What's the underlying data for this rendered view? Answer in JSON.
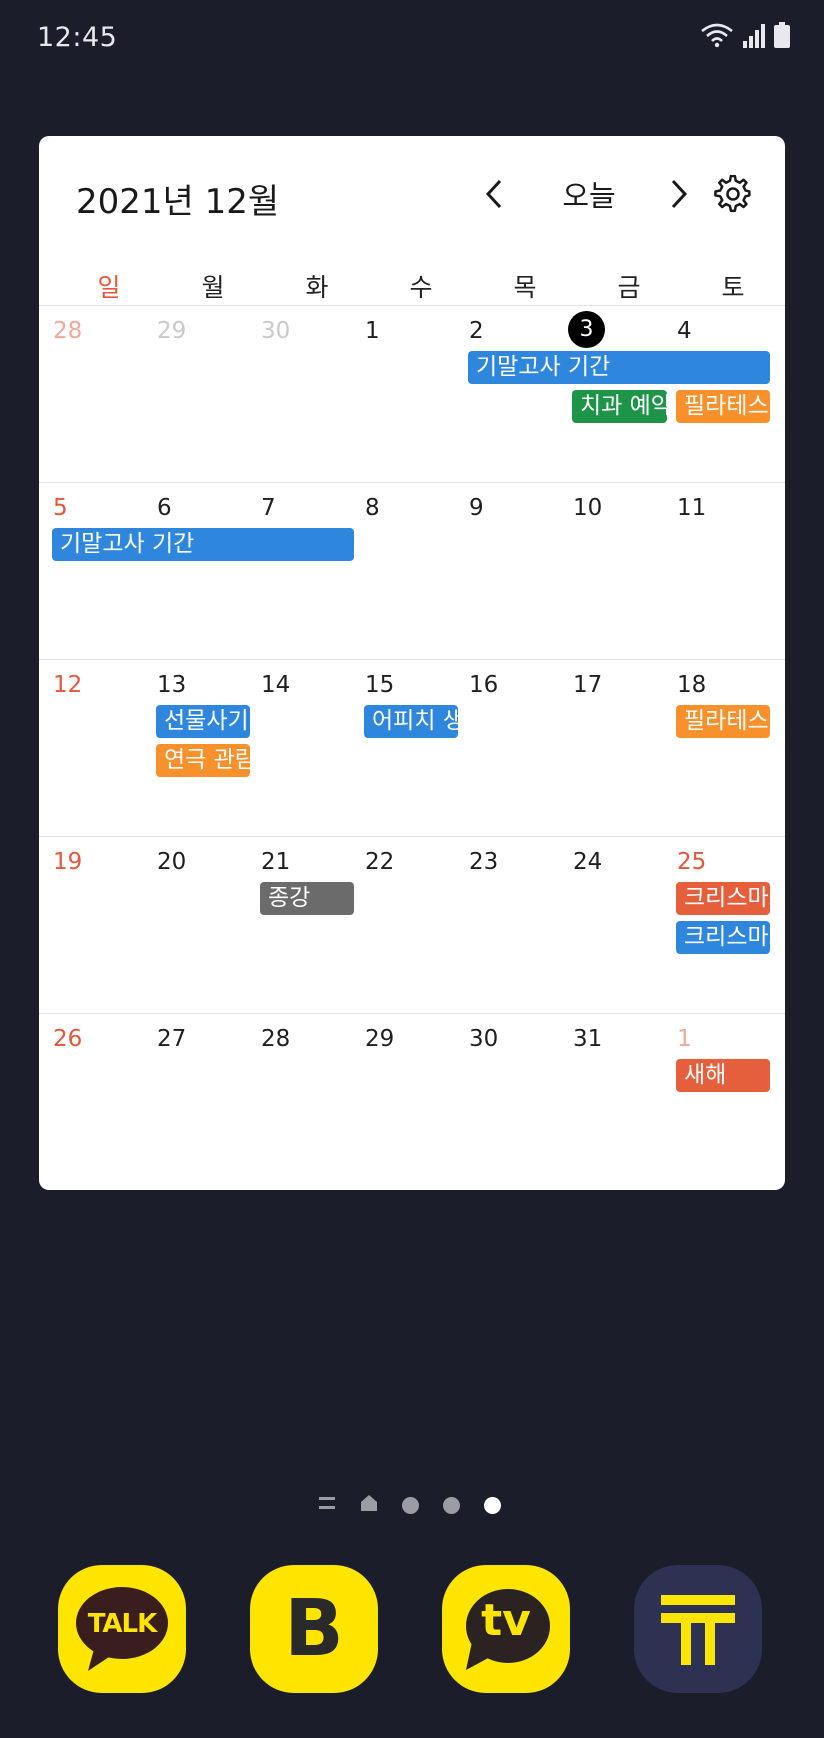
{
  "status_bar": {
    "time": "12:45"
  },
  "widget": {
    "title": "2021년 12월",
    "today_label": "오늘",
    "weekdays": [
      "일",
      "월",
      "화",
      "수",
      "목",
      "금",
      "토"
    ],
    "weeks": [
      {
        "days": [
          "28",
          "29",
          "30",
          "1",
          "2",
          "3",
          "4"
        ],
        "events": [
          {
            "label": "기말고사 기간",
            "color": "#2f86dd"
          },
          {
            "label": "치과 예약",
            "color": "#1e9449"
          },
          {
            "label": "필라테스",
            "color": "#f8912c"
          }
        ]
      },
      {
        "days": [
          "5",
          "6",
          "7",
          "8",
          "9",
          "10",
          "11"
        ],
        "events": [
          {
            "label": "기말고사 기간",
            "color": "#2f86dd"
          }
        ]
      },
      {
        "days": [
          "12",
          "13",
          "14",
          "15",
          "16",
          "17",
          "18"
        ],
        "events": [
          {
            "label": "선물사기",
            "color": "#2f86dd"
          },
          {
            "label": "연극 관람",
            "color": "#f8912c"
          },
          {
            "label": "어피치 생일",
            "color": "#2f86dd"
          },
          {
            "label": "필라테스",
            "color": "#f8912c"
          }
        ]
      },
      {
        "days": [
          "19",
          "20",
          "21",
          "22",
          "23",
          "24",
          "25"
        ],
        "events": [
          {
            "label": "종강",
            "color": "#6b6b6b"
          },
          {
            "label": "크리스마스",
            "color": "#e65f3c"
          },
          {
            "label": "크리스마스",
            "color": "#2f86dd"
          }
        ]
      },
      {
        "days": [
          "26",
          "27",
          "28",
          "29",
          "30",
          "31",
          "1"
        ],
        "events": [
          {
            "label": "새해",
            "color": "#e65f3c"
          }
        ]
      }
    ]
  },
  "dock": {
    "apps": [
      {
        "name": "kakaotalk",
        "label": "TALK"
      },
      {
        "name": "kakao-blog",
        "label": "B"
      },
      {
        "name": "kakao-tv",
        "label": "tv"
      },
      {
        "name": "kakao-t",
        "label": ""
      }
    ]
  },
  "colors": {
    "background": "#1b1d2b",
    "sunday": "#e1583a",
    "kakao_yellow": "#fee500"
  }
}
